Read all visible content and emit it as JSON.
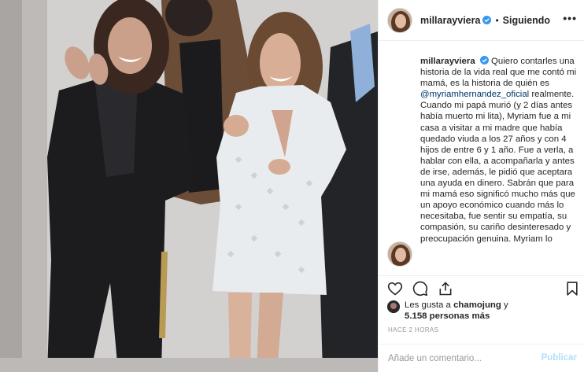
{
  "post": {
    "username": "millarayviera",
    "separator": "•",
    "follow_status": "Siguiendo",
    "more_label": "•••"
  },
  "caption": {
    "username": "millarayviera",
    "text_intro": "Quiero contarles una historia de la vida real que me contó mi mamá, es la historia de quién es ",
    "mention": "@myriamhernandez_oficial",
    "text_body": " realmente.\nCuando mi papá murió (y 2 días antes había muerto mi lita), Myriam fue a mi casa a visitar a mi madre que había quedado viuda a los 27 años y con 4 hijos de entre 6 y 1 año. Fue a verla, a hablar con ella, a acompañarla y antes de irse, además, le pidió que aceptara una ayuda en dinero. Sabrán que para mi mamá eso significó mucho más que un apoyo económico cuando más lo necesitaba, fue sentir su empatía, su compasión, su cariño desinteresado y preocupación genuina. Myriam lo"
  },
  "likes": {
    "prefix": "Les gusta a ",
    "user": "chamojung",
    "middle": " y",
    "count": "5.158 personas más"
  },
  "timestamp": "HACE 2 HORAS",
  "comment": {
    "placeholder": "Añade un comentario...",
    "publish_label": "Publicar"
  },
  "icons": {
    "like": "heart-icon",
    "comment": "comment-icon",
    "share": "share-icon",
    "save": "bookmark-icon",
    "verified": "verified-badge-icon"
  },
  "colors": {
    "verified": "#3897f0",
    "mention": "#003569",
    "publish_disabled": "#b2dffc",
    "timestamp": "#999999"
  }
}
